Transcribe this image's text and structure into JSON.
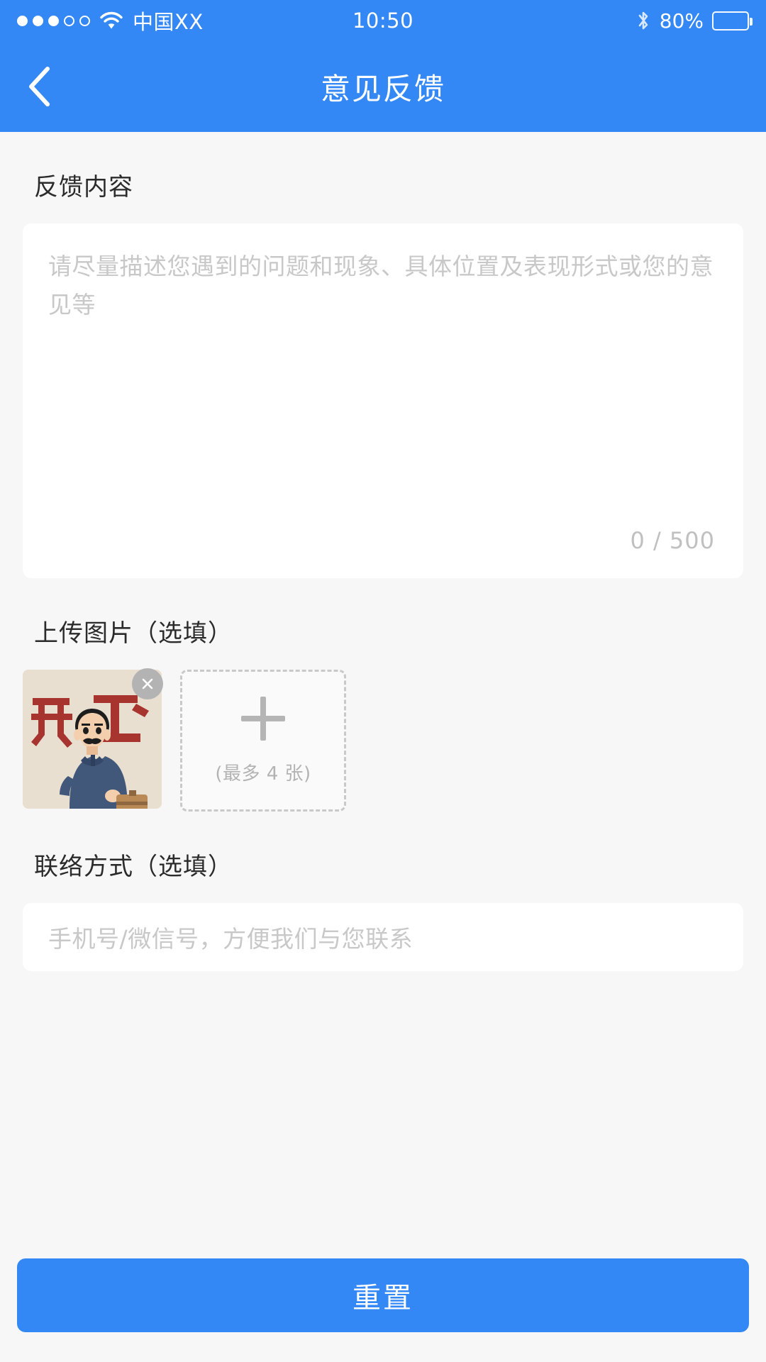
{
  "theme": {
    "accent": "#3388f5",
    "page_bg": "#f7f7f7",
    "card_bg": "#ffffff",
    "placeholder_color": "#c8c8c8",
    "label_color": "#2b2b2b"
  },
  "status_bar": {
    "signal_dots_filled": 3,
    "signal_dots_total": 5,
    "wifi_icon": "wifi-icon",
    "carrier": "中国XX",
    "time": "10:50",
    "bluetooth_icon": "bluetooth-icon",
    "battery_percent": "80%",
    "battery_level": 80
  },
  "nav": {
    "back_icon": "chevron-left-icon",
    "title": "意见反馈"
  },
  "feedback": {
    "label": "反馈内容",
    "placeholder": "请尽量描述您遇到的问题和现象、具体位置及表现形式或您的意见等",
    "value": "",
    "char_count": 0,
    "char_max": 500,
    "counter_text": "0 / 500"
  },
  "upload": {
    "label": "上传图片（选填）",
    "max_hint": "(最多 4 张)",
    "max_count": 4,
    "plus_icon": "plus-icon",
    "thumbnails": [
      {
        "remove_icon": "close-circle-icon",
        "alt": "开工"
      }
    ]
  },
  "contact": {
    "label": "联络方式（选填）",
    "placeholder": "手机号/微信号，方便我们与您联系",
    "value": ""
  },
  "footer": {
    "button_label": "重置"
  }
}
